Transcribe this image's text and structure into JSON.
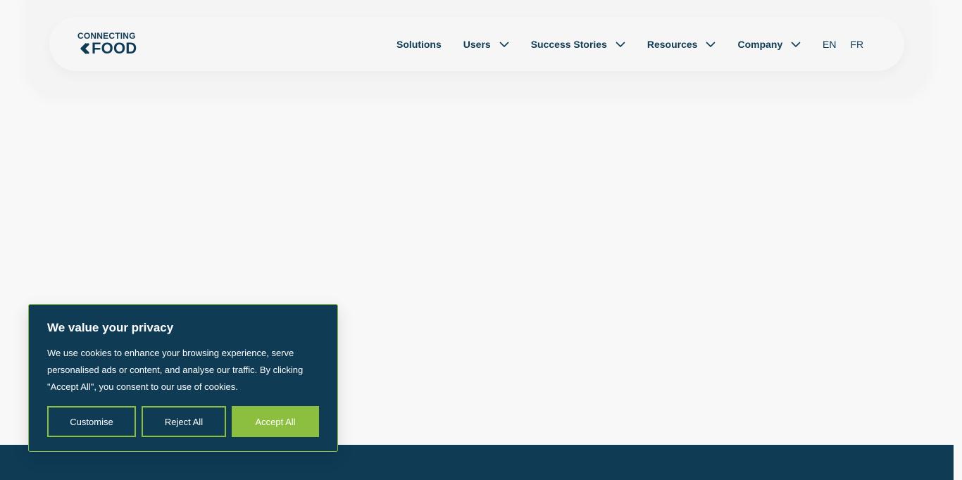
{
  "brand": {
    "line1": "CONNECTING",
    "line2": "FOOD"
  },
  "nav": {
    "items": [
      {
        "label": "Solutions",
        "has_dropdown": false
      },
      {
        "label": "Users",
        "has_dropdown": true
      },
      {
        "label": "Success Stories",
        "has_dropdown": true
      },
      {
        "label": "Resources",
        "has_dropdown": true
      },
      {
        "label": "Company",
        "has_dropdown": true
      }
    ],
    "languages": [
      "EN",
      "FR"
    ]
  },
  "cookie_banner": {
    "title": "We value your privacy",
    "body": "We use cookies to enhance your browsing experience, serve personalised ads or content, and analyse our traffic. By clicking \"Accept All\", you consent to our use of cookies.",
    "buttons": {
      "customise": "Customise",
      "reject": "Reject All",
      "accept": "Accept All"
    }
  },
  "colors": {
    "navy": "#0f3b55",
    "green": "#8cbf3f",
    "page_bg": "#f8f8f8"
  },
  "icons": {
    "chevron": "chevron-down-icon",
    "logo_mark": "connecting-food-mark-icon"
  }
}
